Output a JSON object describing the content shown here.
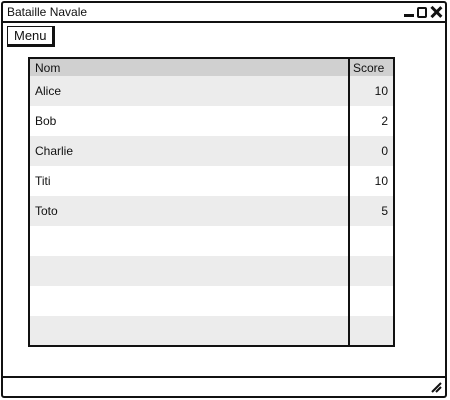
{
  "window": {
    "title": "Bataille Navale",
    "controls": [
      "minimize-icon",
      "maximize-icon",
      "close-icon"
    ]
  },
  "menu": {
    "label": "Menu"
  },
  "table": {
    "columns": [
      "Nom",
      "Score"
    ],
    "rows": [
      {
        "name": "Alice",
        "score": "10"
      },
      {
        "name": "Bob",
        "score": "2"
      },
      {
        "name": "Charlie",
        "score": "0"
      },
      {
        "name": "Titi",
        "score": "10"
      },
      {
        "name": "Toto",
        "score": "5"
      },
      {
        "name": "",
        "score": ""
      },
      {
        "name": "",
        "score": ""
      },
      {
        "name": "",
        "score": ""
      },
      {
        "name": "",
        "score": ""
      }
    ],
    "header_color": "#d0d0d0",
    "stripe_color": "#ececec"
  },
  "statusbar": {
    "icon": "resize-grip-icon"
  }
}
